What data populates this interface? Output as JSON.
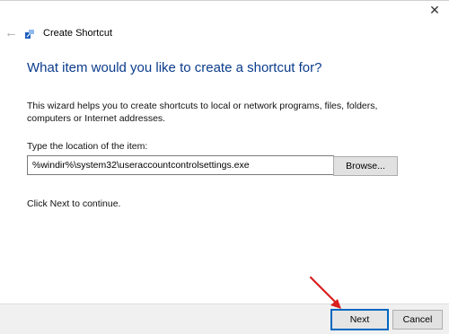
{
  "window": {
    "title": "Create Shortcut",
    "close_glyph": "✕",
    "back_glyph": "←"
  },
  "main": {
    "heading": "What item would you like to create a shortcut for?",
    "description": "This wizard helps you to create shortcuts to local or network programs, files, folders, computers or Internet addresses.",
    "location_label": "Type the location of the item:",
    "location_value": "%windir%\\system32\\useraccountcontrolsettings.exe",
    "browse_label": "Browse...",
    "hint": "Click Next to continue."
  },
  "footer": {
    "next_label": "Next",
    "cancel_label": "Cancel"
  },
  "colors": {
    "heading": "#0b3c8c",
    "annotation_arrow": "#d9201f",
    "default_button_border": "#0067c0"
  },
  "icons": [
    "close-icon",
    "back-arrow-icon",
    "shortcut-wizard-icon"
  ]
}
